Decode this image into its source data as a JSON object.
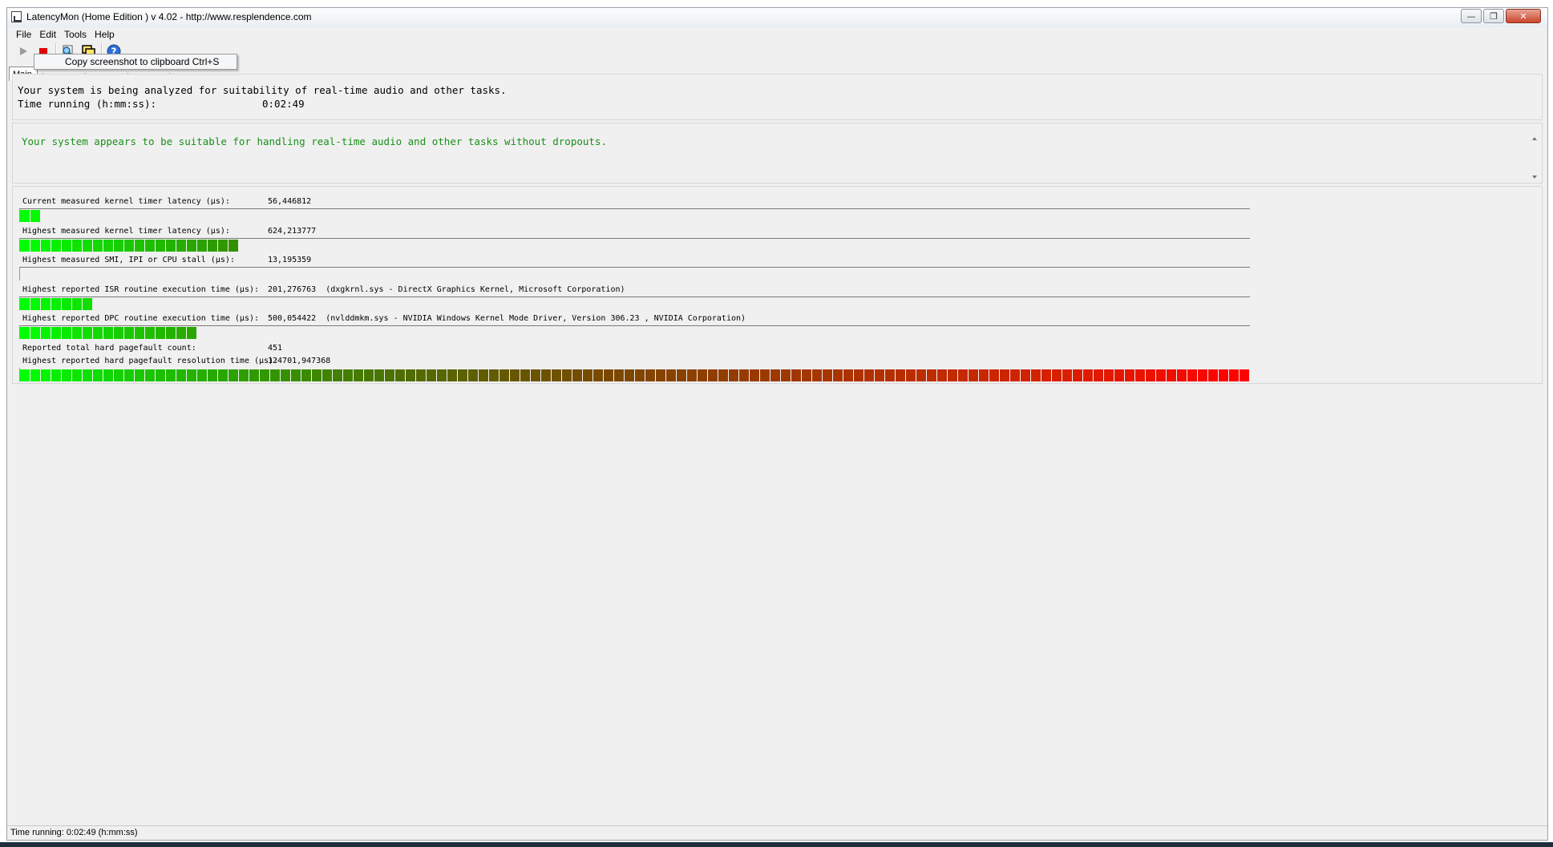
{
  "window": {
    "title": "LatencyMon  (Home Edition )  v 4.02 - http://www.resplendence.com",
    "controls": {
      "minimize": "—",
      "restore": "❐",
      "close": "✕"
    }
  },
  "menu": [
    "File",
    "Edit",
    "Tools",
    "Help"
  ],
  "toolbar": {
    "buttons": [
      {
        "name": "start-button",
        "icon": "play-icon"
      },
      {
        "name": "stop-button",
        "icon": "stop-icon"
      },
      {
        "name": "report-button",
        "icon": "magnifier-report-icon"
      },
      {
        "name": "screenshot-button",
        "icon": "copy-screenshot-icon"
      },
      {
        "name": "help-button",
        "icon": "help-icon"
      }
    ],
    "tooltip": "Copy screenshot to clipboard Ctrl+S"
  },
  "tabs": {
    "active": "Main"
  },
  "status": {
    "line1": "Your system is being analyzed for suitability of real-time audio and other tasks.",
    "time_label": "Time running (h:mm:ss):",
    "time_value": "0:02:49"
  },
  "verdict": "Your system appears to be suitable for handling real-time audio and other tasks without dropouts.",
  "colors": {
    "verdict": "#1a8f1a",
    "meter_low": "#00ff00",
    "meter_high": "#ff0000"
  },
  "metrics": [
    {
      "label": "Current measured kernel timer latency (µs):",
      "value": "56,446812",
      "blocks": 2
    },
    {
      "label": "Highest measured kernel timer latency (µs):",
      "value": "624,213777",
      "blocks": 21
    },
    {
      "label": "Highest measured SMI, IPI or CPU stall (µs):",
      "value": "13,195359",
      "blocks": 0
    },
    {
      "label": "Highest reported ISR routine execution time (µs):",
      "value": "201,276763  (dxgkrnl.sys - DirectX Graphics Kernel, Microsoft Corporation)",
      "blocks": 7
    },
    {
      "label": "Highest reported DPC routine execution time (µs):",
      "value": "500,054422  (nvlddmkm.sys - NVIDIA Windows Kernel Mode Driver, Version 306.23 , NVIDIA Corporation)",
      "blocks": 17
    }
  ],
  "pagefault": {
    "count_label": "Reported total hard pagefault count:",
    "count_value": "451",
    "res_label": "Highest reported hard pagefault resolution time (µs):",
    "res_value": "124701,947368",
    "blocks": 118
  },
  "statusbar": "Time running: 0:02:49  (h:mm:ss)"
}
